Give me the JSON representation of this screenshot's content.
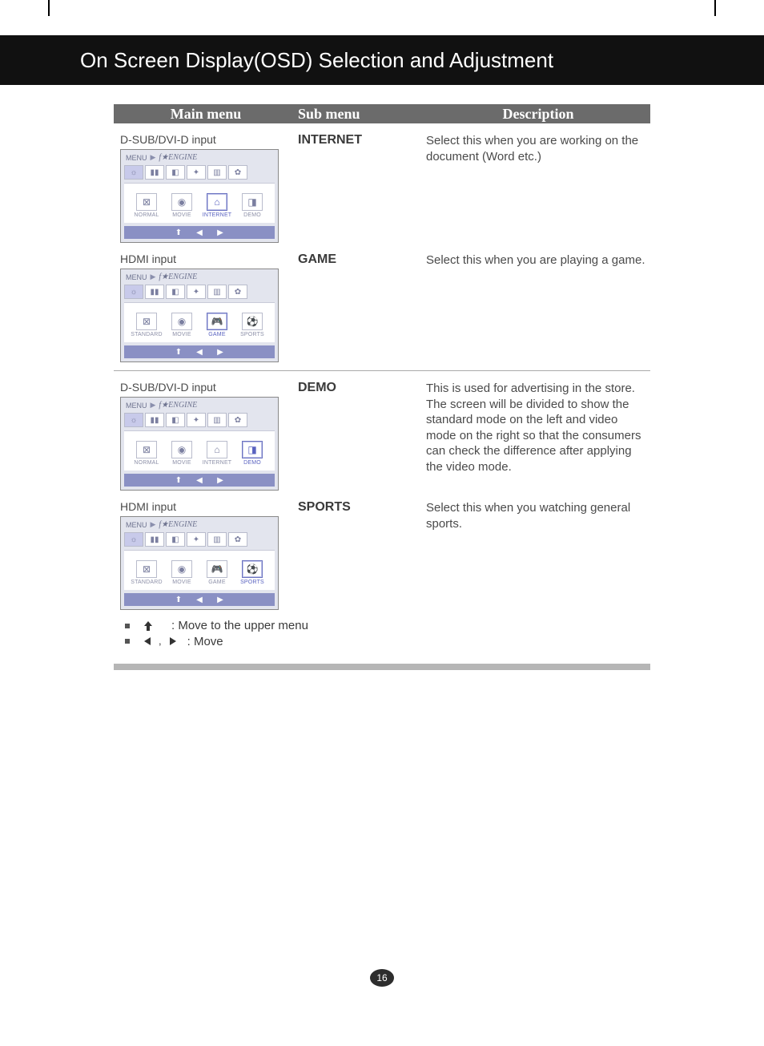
{
  "pageTitle": "On Screen Display(OSD) Selection and Adjustment",
  "columns": {
    "c1": "Main menu",
    "c2": "Sub menu",
    "c3": "Description"
  },
  "sections": [
    {
      "firstLabel": "D-SUB/DVI-D input",
      "secondLabel": "HDMI input",
      "items": [
        {
          "sub": "INTERNET",
          "desc": "Select this when you are working on the document (Word etc.)",
          "osd": {
            "crumb": [
              "MENU",
              "f★ENGINE"
            ],
            "modes": [
              "NORMAL",
              "MOVIE",
              "INTERNET",
              "DEMO"
            ],
            "selected": "INTERNET"
          }
        },
        {
          "sub": "GAME",
          "desc": "Select this when you are playing a game.",
          "osd": {
            "crumb": [
              "MENU",
              "f★ENGINE"
            ],
            "modes": [
              "STANDARD",
              "MOVIE",
              "GAME",
              "SPORTS"
            ],
            "selected": "GAME"
          }
        }
      ]
    },
    {
      "firstLabel": "D-SUB/DVI-D input",
      "secondLabel": "HDMI input",
      "items": [
        {
          "sub": "DEMO",
          "desc": "This is used for advertising in the store. The screen will be divided to show the standard mode on the left and video mode on the right so that the consumers can check the difference after applying the video mode.",
          "osd": {
            "crumb": [
              "MENU",
              "f★ENGINE"
            ],
            "modes": [
              "NORMAL",
              "MOVIE",
              "INTERNET",
              "DEMO"
            ],
            "selected": "DEMO"
          }
        },
        {
          "sub": "SPORTS",
          "desc": "Select this when you watching general sports.",
          "osd": {
            "crumb": [
              "MENU",
              "f★ENGINE"
            ],
            "modes": [
              "STANDARD",
              "MOVIE",
              "GAME",
              "SPORTS"
            ],
            "selected": "SPORTS"
          }
        }
      ]
    }
  ],
  "legend": {
    "up": ": Move to the upper menu",
    "leftright": ": Move",
    "comma": ","
  },
  "osdTabs": [
    "☼",
    "▮▮",
    "◧",
    "✦",
    "▥",
    "✿"
  ],
  "modeIcons": {
    "NORMAL": "⊠",
    "STANDARD": "⊠",
    "MOVIE": "◉",
    "INTERNET": "⌂",
    "GAME": "🎮",
    "DEMO": "◨",
    "SPORTS": "⚽"
  },
  "footerNav": {
    "up": "⬆",
    "left": "◀",
    "right": "▶"
  },
  "pageNumber": "16"
}
